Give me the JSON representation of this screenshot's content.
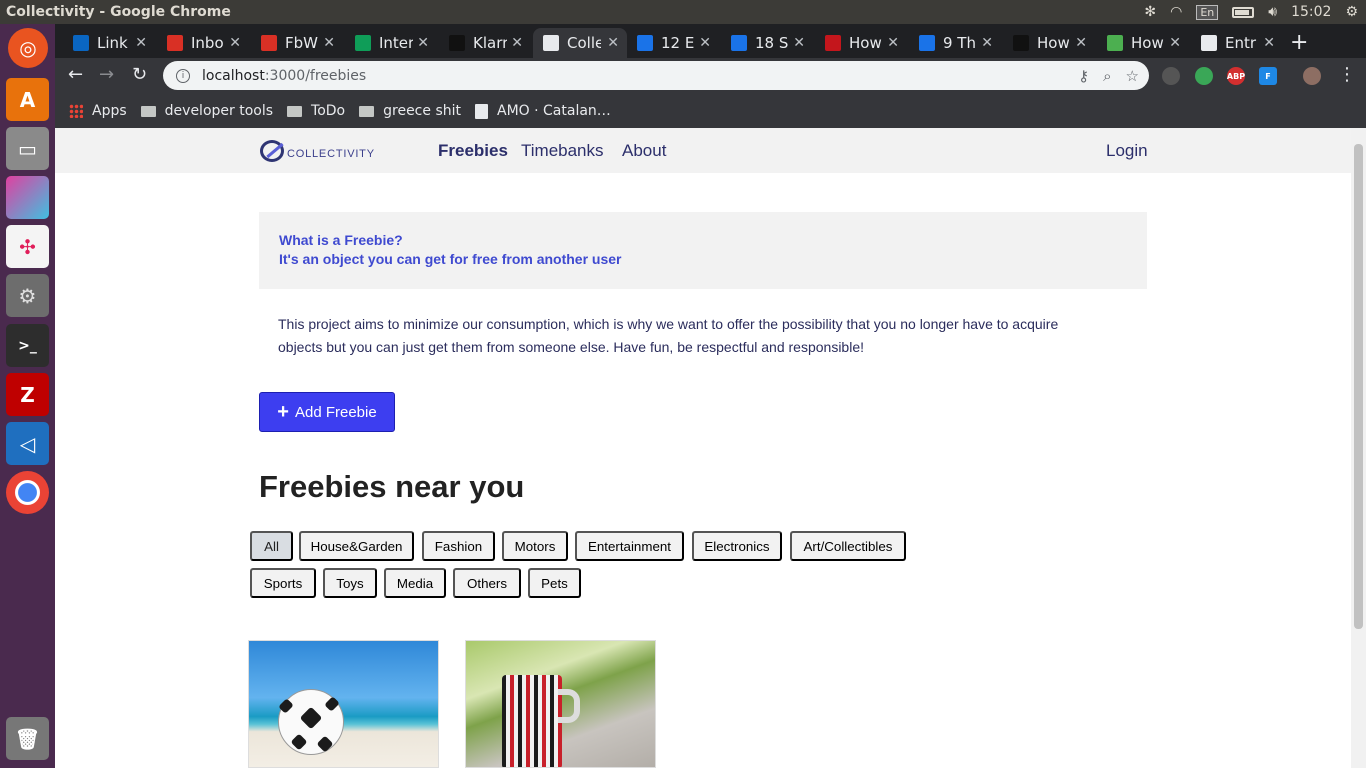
{
  "os": {
    "window_title": "Collectivity - Google Chrome",
    "lang": "En",
    "time": "15:02"
  },
  "tabs": [
    {
      "label": "Link",
      "icon": "linkedin-icon",
      "color": "#0a66c2"
    },
    {
      "label": "Inbo",
      "icon": "gmail-icon",
      "color": "#d93025"
    },
    {
      "label": "FbW",
      "icon": "gmail-icon",
      "color": "#d93025"
    },
    {
      "label": "Inter",
      "icon": "sheets-icon",
      "color": "#0f9d58"
    },
    {
      "label": "Klarr",
      "icon": "github-icon",
      "color": "#111111"
    },
    {
      "label": "Colle",
      "icon": "collectivity-icon",
      "color": "#e8eaed",
      "active": true
    },
    {
      "label": "12 E",
      "icon": "calendar-icon",
      "color": "#1a73e8"
    },
    {
      "label": "18 S",
      "icon": "r-icon",
      "color": "#1a73e8"
    },
    {
      "label": "How",
      "icon": "hbr-icon",
      "color": "#c4161c"
    },
    {
      "label": "9 Th",
      "icon": "chart-icon",
      "color": "#1a73e8"
    },
    {
      "label": "How",
      "icon": "medium-icon",
      "color": "#111111"
    },
    {
      "label": "How",
      "icon": "green-circle-icon",
      "color": "#4caf50"
    },
    {
      "label": "Entr",
      "icon": "e-icon",
      "color": "#e8eaed"
    }
  ],
  "toolbar": {
    "url_host": "localhost",
    "url_path": ":3000/freebies"
  },
  "bookmarks": [
    {
      "label": "Apps",
      "icon": "apps-grid-icon"
    },
    {
      "label": "developer tools",
      "icon": "folder-icon"
    },
    {
      "label": "ToDo",
      "icon": "folder-icon"
    },
    {
      "label": "greece shit",
      "icon": "folder-icon"
    },
    {
      "label": "AMO · Catalan…",
      "icon": "amo-icon"
    }
  ],
  "app": {
    "logo_text": "COLLECTIVITY",
    "nav": {
      "freebies": "Freebies",
      "timebanks": "Timebanks",
      "about": "About",
      "login": "Login"
    },
    "info": {
      "question": "What is a Freebie?",
      "answer": "It's an object you can get for free from another user"
    },
    "description": "This project aims to minimize our consumption, which is why we want to offer the possibility that you no longer have to acquire objects but you can just get them from someone else. Have fun, be respectful and responsible!",
    "add_button": "Add Freebie",
    "section_title": "Freebies near you",
    "categories": [
      "All",
      "House&Garden",
      "Fashion",
      "Motors",
      "Entertainment",
      "Electronics",
      "Art/Collectibles",
      "Sports",
      "Toys",
      "Media",
      "Others",
      "Pets"
    ],
    "selected_category": "All"
  },
  "colors": {
    "accent": "#3d3ef0",
    "info_text": "#3f4ad0",
    "nav_text": "#2c2f6b"
  }
}
